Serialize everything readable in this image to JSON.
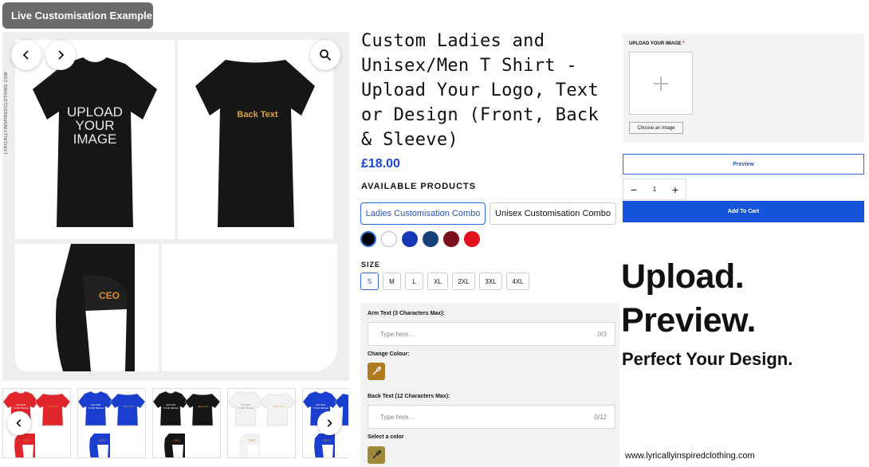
{
  "badge": "Live Customisation Example",
  "gallery": {
    "vertical_brand": "LYRICALLYINSPIREDCLOTHING.COM",
    "front_text_line1": "UPLOAD",
    "front_text_line2": "YOUR",
    "front_text_line3": "IMAGE",
    "back_text": "Back Text",
    "sleeve_text": "CEO",
    "prev_icon": "chevron-left-icon",
    "next_icon": "chevron-right-icon",
    "zoom_icon": "search-icon"
  },
  "thumbnails": [
    {
      "color": "red",
      "shirt": "#e0262a",
      "text": "#ffffff"
    },
    {
      "color": "blue",
      "shirt": "#1a3fcf",
      "text": "#ffffff"
    },
    {
      "color": "black",
      "shirt": "#151515",
      "text": "#ffffff"
    },
    {
      "color": "white",
      "shirt": "#f2f2f2",
      "text": "#888888"
    },
    {
      "color": "blue",
      "shirt": "#1a3fcf",
      "text": "#ffffff"
    }
  ],
  "thumb_text": {
    "upload": "UPLOAD YOUR IMAGE",
    "back": "Back Text",
    "sleeve": "CEO"
  },
  "product": {
    "title": "Custom Ladies and Unisex/Men T Shirt - Upload Your Logo, Text or Design (Front, Back & Sleeve)",
    "price": "£18.00",
    "available_label": "AVAILABLE PRODUCTS",
    "combos": [
      "Ladies Customisation Combo",
      "Unisex Customisation Combo"
    ],
    "selected_combo": "Ladies Customisation Combo",
    "colours": [
      "#000000",
      "#ffffff",
      "#1537b5",
      "#17407a",
      "#7a0f1e",
      "#e3101e"
    ],
    "size_label": "SIZE",
    "sizes": [
      "S",
      "M",
      "L",
      "XL",
      "2XL",
      "3XL",
      "4XL"
    ],
    "selected_size": "S"
  },
  "customise": {
    "arm_label": "Arm Text (3 Characters Max):",
    "arm_placeholder": "Type here...",
    "arm_count": "0/3",
    "change_colour_label": "Change Colour:",
    "back_label": "Back Text (12 Characters Max):",
    "back_placeholder": "Type here...",
    "back_count": "0/12",
    "select_colour_label": "Select a color",
    "picker_icon": "eyedropper-icon"
  },
  "upload": {
    "label": "UPLOAD YOUR IMAGE",
    "required_mark": "*",
    "choose_label": "Choose an image",
    "plus_icon": "plus-icon"
  },
  "actions": {
    "preview_label": "Preview",
    "qty_minus": "−",
    "qty_value": "1",
    "qty_plus": "+",
    "add_to_cart": "Add To Cart"
  },
  "promo": {
    "line1": "Upload.",
    "line2": "Preview.",
    "line3": "Perfect Your Design.",
    "website": "www.lyricallyinspiredclothing.com"
  }
}
